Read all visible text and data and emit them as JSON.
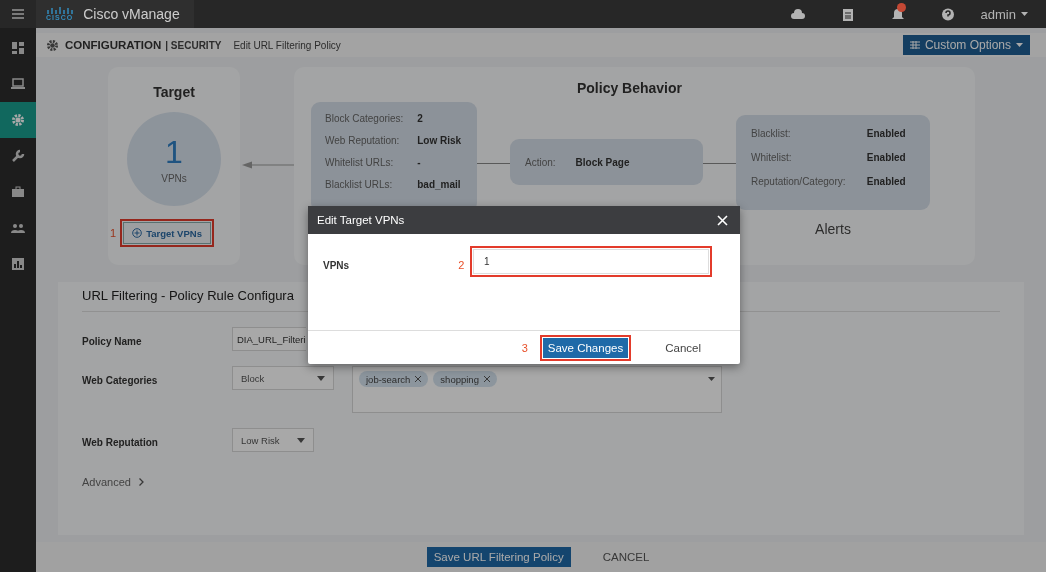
{
  "topbar": {
    "logo_text": "CISCO",
    "brand": "Cisco vManage",
    "user": "admin",
    "notification": true
  },
  "sidebar": {
    "items": [
      {
        "kind": "dashboard",
        "selected": false
      },
      {
        "kind": "monitor",
        "selected": false
      },
      {
        "kind": "settings",
        "selected": true
      },
      {
        "kind": "tools",
        "selected": false
      },
      {
        "kind": "toolbox",
        "selected": false
      },
      {
        "kind": "users",
        "selected": false
      },
      {
        "kind": "analytics",
        "selected": false
      }
    ]
  },
  "breadcrumb": {
    "section": "CONFIGURATION",
    "subsection": "| SECURITY",
    "page": "Edit URL Filtering Policy",
    "custom_options": "Custom Options"
  },
  "target": {
    "title": "Target",
    "count": "1",
    "unit": "VPNs",
    "step": "1",
    "button": "Target VPNs"
  },
  "policy_behavior": {
    "title": "Policy Behavior",
    "filter_rows": [
      {
        "label": "Block Categories:",
        "value": "2"
      },
      {
        "label": "Web Reputation:",
        "value": "Low Risk"
      },
      {
        "label": "Whitelist URLs:",
        "value": "-"
      },
      {
        "label": "Blacklist URLs:",
        "value": "bad_mail"
      }
    ],
    "action": {
      "label": "Action:",
      "value": "Block Page"
    },
    "alert_rows": [
      {
        "label": "Blacklist:",
        "value": "Enabled"
      },
      {
        "label": "Whitelist:",
        "value": "Enabled"
      },
      {
        "label": "Reputation/Category:",
        "value": "Enabled"
      }
    ],
    "alerts_caption": "Alerts"
  },
  "config": {
    "title": "URL Filtering - Policy Rule Configura",
    "fields": [
      {
        "kind": "text",
        "label": "Policy Name",
        "value": "DIA_URL_Filteri"
      },
      {
        "kind": "select_tags",
        "label": "Web Categories",
        "value": "Block",
        "tags": [
          "job-search",
          "shopping"
        ]
      },
      {
        "kind": "select",
        "label": "Web Reputation",
        "value": "Low Risk"
      }
    ],
    "advanced": "Advanced"
  },
  "footer": {
    "save": "Save URL Filtering Policy",
    "cancel": "CANCEL"
  },
  "modal": {
    "title": "Edit Target VPNs",
    "field_label": "VPNs",
    "field_step": "2",
    "value": "1",
    "save_step": "3",
    "save": "Save Changes",
    "cancel": "Cancel"
  }
}
